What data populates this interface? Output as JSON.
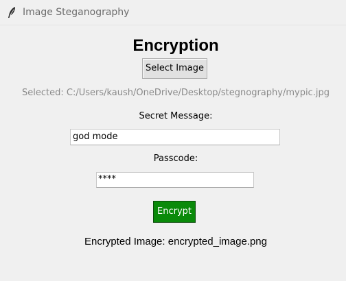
{
  "window": {
    "title": "Image Steganography",
    "icon": "feather-icon"
  },
  "main": {
    "heading": "Encryption",
    "select_button_label": "Select Image",
    "selected_path": "Selected: C:/Users/kaush/OneDrive/Desktop/stegnography/mypic.jpg",
    "secret_label": "Secret Message:",
    "secret_value": "god mode",
    "passcode_label": "Passcode:",
    "passcode_value": "****",
    "encrypt_button_label": "Encrypt",
    "result_text": "Encrypted Image: encrypted_image.png"
  },
  "colors": {
    "background": "#f0f0f0",
    "encrypt_button": "#0a8a0a",
    "muted_text": "#8a8a8a"
  }
}
